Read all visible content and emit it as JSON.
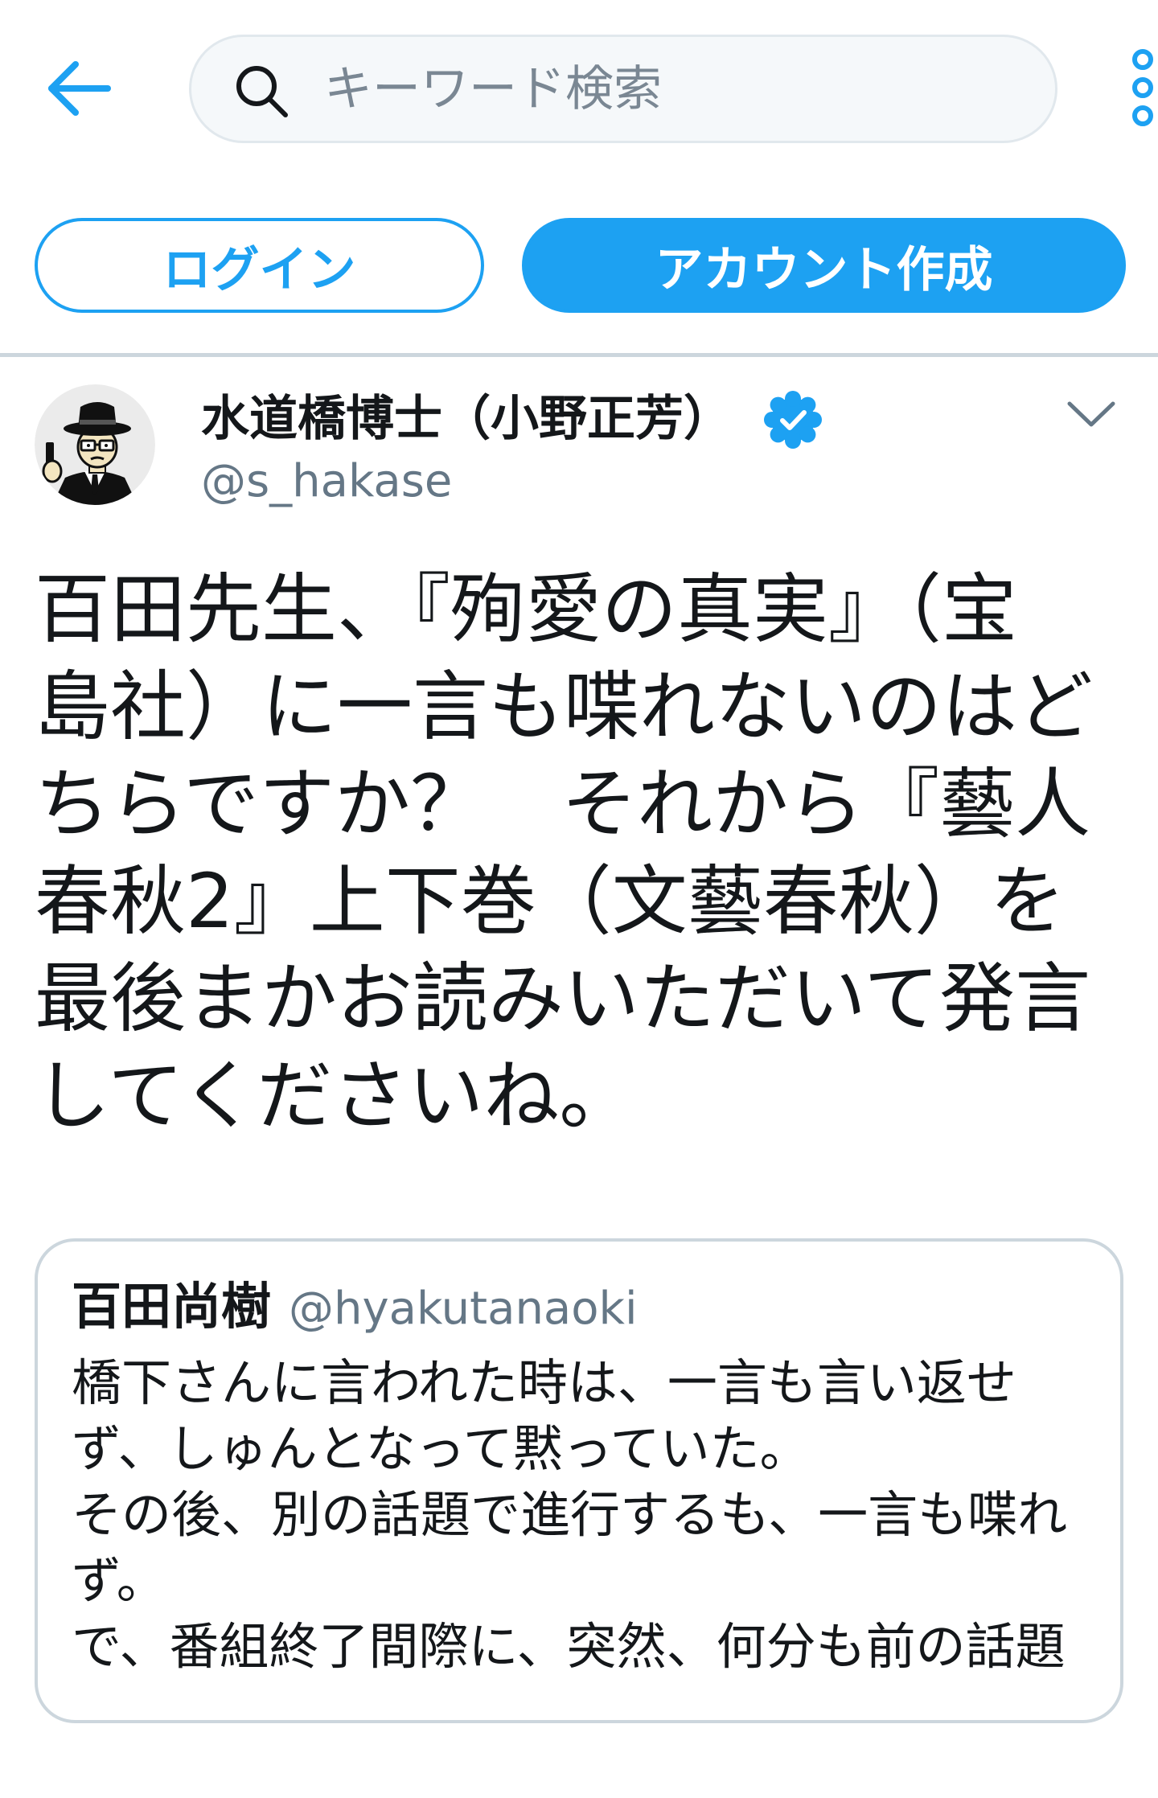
{
  "header": {
    "back_icon": "arrow-left-icon",
    "search": {
      "icon": "search-icon",
      "placeholder": "キーワード検索",
      "value": ""
    },
    "more_icon": "more-vertical-icon"
  },
  "auth": {
    "login_label": "ログイン",
    "signup_label": "アカウント作成"
  },
  "tweet": {
    "author_name": "水道橋博士（小野正芳）",
    "handle": "@s_hakase",
    "verified": true,
    "verified_icon": "verified-badge-icon",
    "menu_icon": "chevron-down-icon",
    "text_lines": [
      "百田先生、『殉愛の真実』（宝",
      "島社）に一言も喋れないのはど",
      "ちらですか？　それから『藝人",
      "春秋2』上下巻（文藝春秋）を",
      "最後まかお読みいただいて発言",
      "してくださいね。"
    ]
  },
  "quote": {
    "author_name": "百田尚樹",
    "handle": "@hyakutanaoki",
    "text_lines": [
      "橋下さんに言われた時は、一言も言い返せ",
      "ず、しゅんとなって黙っていた。",
      "その後、別の話題で進行するも、一言も喋れ",
      "ず。",
      "で、番組終了間際に、突然、何分も前の話題"
    ]
  },
  "colors": {
    "accent": "#1da1f2",
    "text": "#14171a",
    "muted": "#657786",
    "border": "#ccd6dd",
    "search_bg": "#f5f8fa"
  }
}
